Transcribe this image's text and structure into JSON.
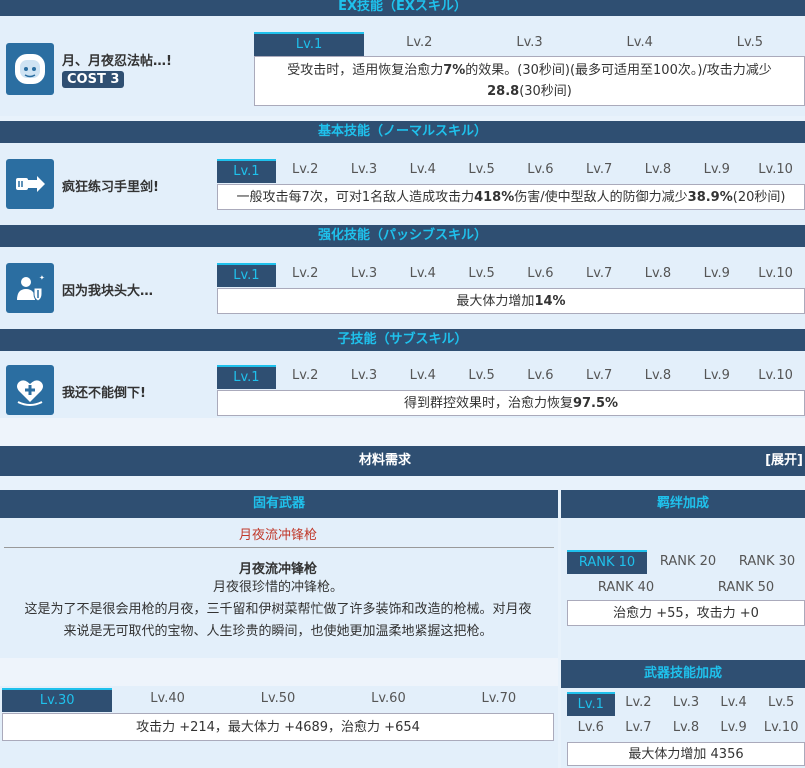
{
  "ex": {
    "header": "EX技能（EXスキル）",
    "name": "月、月夜忍法帖…!",
    "cost": "COST 3",
    "levels": [
      "Lv.1",
      "Lv.2",
      "Lv.3",
      "Lv.4",
      "Lv.5"
    ],
    "desc_line1": "受攻击时，适用恢复治愈力",
    "desc_v1": "7%",
    "desc_line1b": "的效果。(30秒间)(最多可适用至100次。)/攻击力减少",
    "desc_v2": "28.8",
    "desc_line2b": "(30秒间)"
  },
  "normal": {
    "header": "基本技能（ノーマルスキル）",
    "name": "疯狂练习手里剑!",
    "levels": [
      "Lv.1",
      "Lv.2",
      "Lv.3",
      "Lv.4",
      "Lv.5",
      "Lv.6",
      "Lv.7",
      "Lv.8",
      "Lv.9",
      "Lv.10"
    ],
    "desc_a": "一般攻击每7次，可对1名敌人造成攻击力",
    "desc_v1": "418%",
    "desc_b": "伤害/使中型敌人的防御力减少",
    "desc_v2": "38.9%",
    "desc_c": "(20秒间)"
  },
  "passive": {
    "header": "强化技能（パッシブスキル）",
    "name": "因为我块头大…",
    "levels": [
      "Lv.1",
      "Lv.2",
      "Lv.3",
      "Lv.4",
      "Lv.5",
      "Lv.6",
      "Lv.7",
      "Lv.8",
      "Lv.9",
      "Lv.10"
    ],
    "desc_a": "最大体力增加",
    "desc_v1": "14%"
  },
  "sub": {
    "header": "子技能（サブスキル）",
    "name": "我还不能倒下!",
    "levels": [
      "Lv.1",
      "Lv.2",
      "Lv.3",
      "Lv.4",
      "Lv.5",
      "Lv.6",
      "Lv.7",
      "Lv.8",
      "Lv.9",
      "Lv.10"
    ],
    "desc_a": "得到群控效果时，治愈力恢复",
    "desc_v1": "97.5%"
  },
  "materials": {
    "title": "材料需求",
    "expand": "[展开]"
  },
  "weapon": {
    "header": "固有武器",
    "name_red": "月夜流冲锋枪",
    "title": "月夜流冲锋枪",
    "subtitle": "月夜很珍惜的冲锋枪。",
    "text1": "这是为了不是很会用枪的月夜，三千留和伊树菜帮忙做了许多装饰和改造的枪械。对月夜",
    "text2": "来说是无可取代的宝物、人生珍贵的瞬间，也使她更加温柔地紧握这把枪。",
    "levels": [
      "Lv.30",
      "Lv.40",
      "Lv.50",
      "Lv.60",
      "Lv.70"
    ],
    "stats": "攻击力 +214，最大体力 +4689，治愈力 +654"
  },
  "bond": {
    "header": "羁绊加成",
    "ranks": [
      "RANK 10",
      "RANK 20",
      "RANK 30",
      "RANK 40",
      "RANK 50"
    ],
    "stats": "治愈力 +55，攻击力 +0"
  },
  "weapon_skill": {
    "header": "武器技能加成",
    "levels": [
      "Lv.1",
      "Lv.2",
      "Lv.3",
      "Lv.4",
      "Lv.5",
      "Lv.6",
      "Lv.7",
      "Lv.8",
      "Lv.9",
      "Lv.10"
    ],
    "stats": "最大体力增加 4356"
  },
  "colors": {
    "navy": "#2f4f72",
    "cyan": "#1fc1ec",
    "weapon_red": "#c0392b"
  }
}
